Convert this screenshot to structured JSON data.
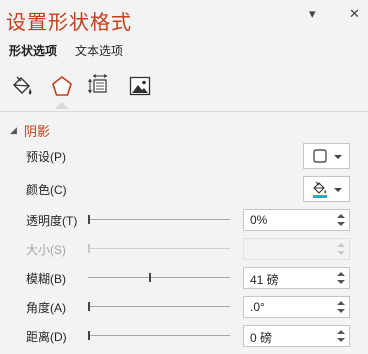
{
  "pane": {
    "title": "设置形状格式",
    "menu_icon": "▾",
    "close_icon": "✕"
  },
  "tabs": [
    {
      "label": "形状选项",
      "active": true
    },
    {
      "label": "文本选项",
      "active": false
    }
  ],
  "category_icons": [
    "fill-line-icon",
    "effects-icon",
    "size-properties-icon",
    "picture-icon"
  ],
  "section": {
    "label": "阴影",
    "expanded": true,
    "accent": "#c43e1c"
  },
  "preset": {
    "label": "预设(P)"
  },
  "color": {
    "label": "颜色(C)",
    "swatch": "#00b0f0"
  },
  "transparency": {
    "label": "透明度(T)",
    "value": "0%",
    "slider_fraction": 0
  },
  "size": {
    "label": "大小(S)",
    "value": "",
    "disabled": true,
    "slider_fraction": 0
  },
  "blur": {
    "label": "模糊(B)",
    "value": "41 磅",
    "slider_fraction": 0.43
  },
  "angle": {
    "label": "角度(A)",
    "value": ".0°",
    "slider_fraction": 0
  },
  "distance": {
    "label": "距离(D)",
    "value": "0 磅",
    "slider_fraction": 0
  }
}
